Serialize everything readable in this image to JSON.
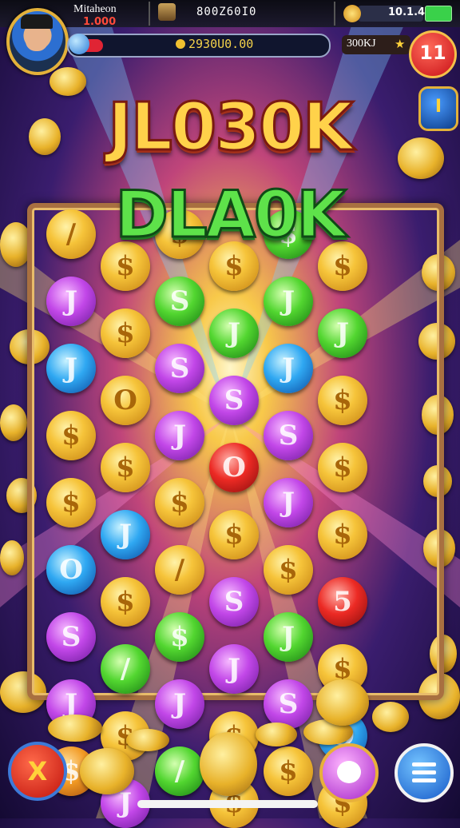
{
  "player": {
    "name": "Mitaheon",
    "level": "1.000"
  },
  "top_code": "800Z60I0",
  "currency": {
    "value": "10.1.4"
  },
  "progress": {
    "text": "2930U0.00",
    "fraction": 0.12
  },
  "side_badge": "300KJ",
  "notification_count": "11",
  "side_button_label": "I",
  "title_line1": "JL030K",
  "title_line2": "DLA0K",
  "exit_button_label": "X",
  "colors": {
    "gold": "#f6c43a",
    "purple": "#c247e8",
    "green": "#52d630",
    "blue": "#2fa8f2",
    "red": "#ec2a24",
    "orange": "#f29a24"
  },
  "board": {
    "tiles": [
      {
        "color": "gold",
        "glyph": "/"
      },
      {
        "color": "gold",
        "glyph": "$"
      },
      {
        "color": "gold",
        "glyph": "$"
      },
      {
        "color": "gold",
        "glyph": "$"
      },
      {
        "color": "green",
        "glyph": "$"
      },
      {
        "color": "gold",
        "glyph": "$"
      },
      {
        "color": "purple",
        "glyph": "J"
      },
      {
        "color": "gold",
        "glyph": "$"
      },
      {
        "color": "green",
        "glyph": "S"
      },
      {
        "color": "green",
        "glyph": "J"
      },
      {
        "color": "green",
        "glyph": "J"
      },
      {
        "color": "green",
        "glyph": "J"
      },
      {
        "color": "blue",
        "glyph": "J"
      },
      {
        "color": "gold",
        "glyph": "O"
      },
      {
        "color": "purple",
        "glyph": "S"
      },
      {
        "color": "purple",
        "glyph": "S"
      },
      {
        "color": "blue",
        "glyph": "J"
      },
      {
        "color": "gold",
        "glyph": "$"
      },
      {
        "color": "gold",
        "glyph": "$"
      },
      {
        "color": "gold",
        "glyph": "$"
      },
      {
        "color": "purple",
        "glyph": "J"
      },
      {
        "color": "red",
        "glyph": "O"
      },
      {
        "color": "purple",
        "glyph": "S"
      },
      {
        "color": "gold",
        "glyph": "$"
      },
      {
        "color": "gold",
        "glyph": "$"
      },
      {
        "color": "blue",
        "glyph": "J"
      },
      {
        "color": "gold",
        "glyph": "$"
      },
      {
        "color": "gold",
        "glyph": "$"
      },
      {
        "color": "purple",
        "glyph": "J"
      },
      {
        "color": "gold",
        "glyph": "$"
      },
      {
        "color": "blue",
        "glyph": "O"
      },
      {
        "color": "gold",
        "glyph": "$"
      },
      {
        "color": "gold",
        "glyph": "/"
      },
      {
        "color": "purple",
        "glyph": "S"
      },
      {
        "color": "gold",
        "glyph": "$"
      },
      {
        "color": "red",
        "glyph": "5"
      },
      {
        "color": "purple",
        "glyph": "S"
      },
      {
        "color": "green",
        "glyph": "/"
      },
      {
        "color": "green",
        "glyph": "$"
      },
      {
        "color": "purple",
        "glyph": "J"
      },
      {
        "color": "green",
        "glyph": "J"
      },
      {
        "color": "gold",
        "glyph": "$"
      },
      {
        "color": "purple",
        "glyph": "J"
      },
      {
        "color": "gold",
        "glyph": "$"
      },
      {
        "color": "purple",
        "glyph": "J"
      },
      {
        "color": "gold",
        "glyph": "$"
      },
      {
        "color": "purple",
        "glyph": "S"
      },
      {
        "color": "blue",
        "glyph": "O"
      },
      {
        "color": "orange",
        "glyph": "$"
      },
      {
        "color": "purple",
        "glyph": "J"
      },
      {
        "color": "green",
        "glyph": "/"
      },
      {
        "color": "gold",
        "glyph": "$"
      },
      {
        "color": "gold",
        "glyph": "$"
      },
      {
        "color": "gold",
        "glyph": "$"
      }
    ]
  }
}
